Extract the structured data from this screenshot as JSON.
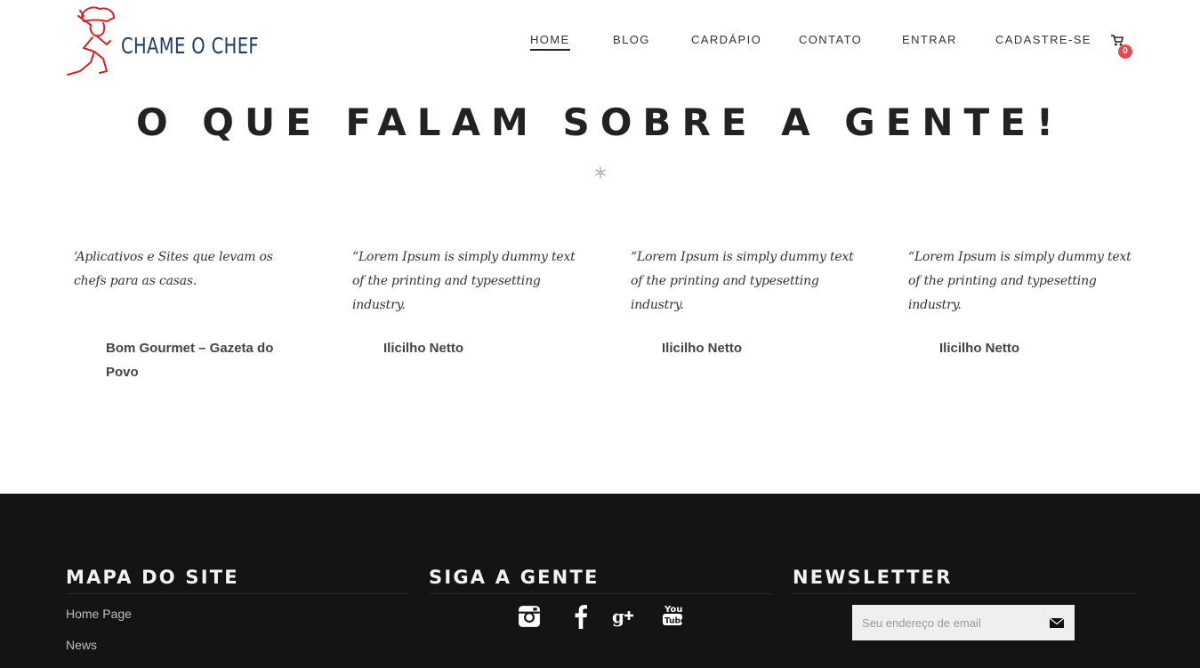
{
  "header": {
    "logo_text": "CHAME O CHEF",
    "nav": [
      "HOME",
      "BLOG",
      "CARDÁPIO",
      "CONTATO",
      "ENTRAR",
      "CADASTRE-SE"
    ],
    "active_nav": "HOME",
    "cart_count": "0"
  },
  "section": {
    "title": "O QUE FALAM SOBRE A GENTE!"
  },
  "testimonials": [
    {
      "quote": "‘Aplicativos e Sites que levam os chefs para as casas.",
      "author": "Bom Gourmet – Gazeta do Povo"
    },
    {
      "quote": "“Lorem Ipsum is simply dummy text of the printing and typesetting industry.",
      "author": "Ilicilho Netto"
    },
    {
      "quote": "“Lorem Ipsum is simply dummy text of the printing and typesetting industry.",
      "author": "Ilicilho Netto"
    },
    {
      "quote": "“Lorem Ipsum is simply dummy text of the printing and typesetting industry.",
      "author": "Ilicilho Netto"
    }
  ],
  "footer": {
    "sitemap_title": "MAPA DO SITE",
    "sitemap_links": [
      "Home Page",
      "News"
    ],
    "social_title": "SIGA A GENTE",
    "social_icons": [
      "instagram-icon",
      "facebook-icon",
      "google-plus-icon",
      "youtube-icon"
    ],
    "newsletter_title": "NEWSLETTER",
    "newsletter_placeholder": "Seu endereço de email"
  },
  "colors": {
    "accent_red": "#e8494a",
    "logo_blue": "#1f3d66",
    "footer_bg": "#141414"
  }
}
